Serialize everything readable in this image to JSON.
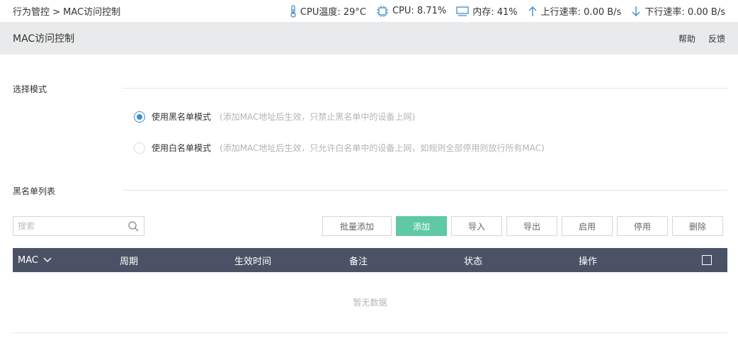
{
  "topbar": {
    "breadcrumb": "行为管控 > MAC访问控制",
    "cpu_temp": "CPU温度: 29°C",
    "cpu": "CPU: 8.71%",
    "memory": "内存: 41%",
    "upload": "上行速率: 0.00 B/s",
    "download": "下行速率: 0.00 B/s"
  },
  "titlebar": {
    "title": "MAC访问控制",
    "help": "帮助",
    "feedback": "反馈"
  },
  "mode": {
    "section_label": "选择模式",
    "options": [
      {
        "label": "使用黑名单模式",
        "hint": "(添加MAC地址后生效，只禁止黑名单中的设备上网)",
        "checked": true
      },
      {
        "label": "使用白名单模式",
        "hint": "(添加MAC地址后生效，只允许白名单中的设备上网，如规则全部停用则放行所有MAC)",
        "checked": false
      }
    ]
  },
  "list": {
    "section_label": "黑名单列表",
    "search_placeholder": "搜索",
    "buttons": {
      "batch_add": "批量添加",
      "add": "添加",
      "import": "导入",
      "export": "导出",
      "enable": "启用",
      "disable": "停用",
      "delete": "删除"
    },
    "columns": {
      "mac": "MAC",
      "period": "周期",
      "effective_time": "生效时间",
      "remark": "备注",
      "status": "状态",
      "action": "操作"
    },
    "empty_text": "暂无数据"
  },
  "colors": {
    "header_bg": "#4c5266",
    "primary_button": "#5fc9a3",
    "radio_accent": "#3e8ed0",
    "icon_blue": "#3e8ed0"
  }
}
